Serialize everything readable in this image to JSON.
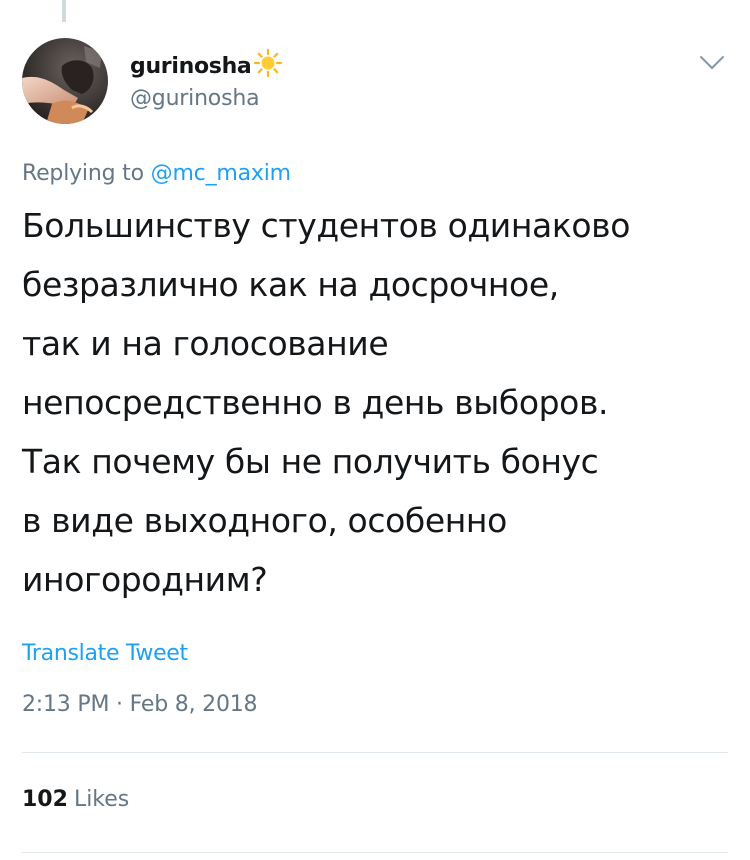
{
  "user": {
    "display_name": "gurinosha",
    "name_emoji_icon": "sun-icon",
    "handle": "@gurinosha",
    "avatar_icon": "avatar-photo"
  },
  "reply": {
    "prefix": "Replying to",
    "mention": "@mc_maxim"
  },
  "tweet": {
    "lines": [
      "Большинству студентов одинаково",
      "безразлично как на досрочное,",
      "так и на голосование",
      "непосредственно в день выборов.",
      "Так почему бы не получить бонус",
      "в виде выходного, особенно",
      "иногородним?"
    ]
  },
  "translate_label": "Translate Tweet",
  "timestamp": "2:13 PM · Feb 8, 2018",
  "likes": {
    "count": "102",
    "label": "Likes"
  },
  "colors": {
    "accent": "#1da1f2",
    "secondary_text": "#657786",
    "primary_text": "#14171a",
    "divider": "#e1e8ed"
  }
}
